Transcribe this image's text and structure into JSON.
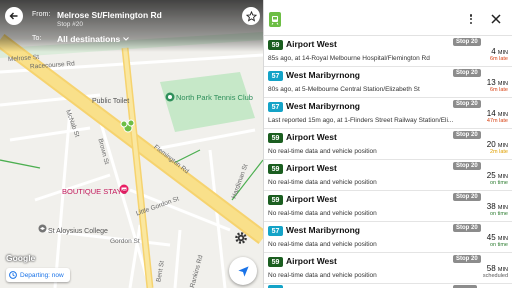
{
  "header": {
    "from_label": "From:",
    "from_value": "Melrose St/Flemington Rd",
    "stop_label": "Stop #20",
    "to_label": "To:",
    "to_value": "All destinations"
  },
  "map": {
    "labels": {
      "tennis": "North Park Tennis Club",
      "toilet": "Public Toilet",
      "boutique": "BOUTIQUE STAYS",
      "college": "St Aloysius College",
      "racecourse": "Racecourse Rd",
      "melrose": "Melrose St",
      "mcnab": "McNab St",
      "little_gordon": "Little Gordon St",
      "gordon": "Gordon St",
      "rankins": "Rankins Rd",
      "hardiman": "Hardiman St",
      "bent": "Bent St",
      "flemington": "Flemington Rd",
      "brown": "Brown St"
    },
    "google_text": "Google",
    "departing_text": "Departing: now"
  },
  "colors": {
    "route_59": "#1b5e20",
    "route_57": "#14a3c7",
    "late": "#d84315",
    "ontime": "#2e7d32",
    "scheduled": "#555555",
    "stop_badge": "#8c8c8c"
  },
  "departures": [
    {
      "route": "59",
      "color": "#1b5e20",
      "dest": "Airport West",
      "sub": "85s ago, at 14-Royal Melbourne Hospital/Flemington Rd",
      "stop": "Stop 20",
      "mins": "4",
      "unit": "MIN",
      "status": "6m late",
      "status_type": "late"
    },
    {
      "route": "57",
      "color": "#14a3c7",
      "dest": "West Maribyrnong",
      "sub": "80s ago, at 5-Melbourne Central Station/Elizabeth St",
      "stop": "Stop 20",
      "mins": "13",
      "unit": "MIN",
      "status": "6m late",
      "status_type": "late"
    },
    {
      "route": "57",
      "color": "#14a3c7",
      "dest": "West Maribyrnong",
      "sub": "Last reported 15m ago, at 1-Flinders Street Railway Station/Eli...",
      "stop": "Stop 20",
      "mins": "14",
      "unit": "MIN",
      "status": "47m late",
      "status_type": "late"
    },
    {
      "route": "59",
      "color": "#1b5e20",
      "dest": "Airport West",
      "sub": "No real-time data and vehicle position",
      "stop": "Stop 20",
      "mins": "20",
      "unit": "MIN",
      "status": "2m late",
      "status_type": "warn"
    },
    {
      "route": "59",
      "color": "#1b5e20",
      "dest": "Airport West",
      "sub": "No real-time data and vehicle position",
      "stop": "Stop 20",
      "mins": "25",
      "unit": "MIN",
      "status": "on time",
      "status_type": "ontime"
    },
    {
      "route": "59",
      "color": "#1b5e20",
      "dest": "Airport West",
      "sub": "No real-time data and vehicle position",
      "stop": "Stop 20",
      "mins": "38",
      "unit": "MIN",
      "status": "on time",
      "status_type": "ontime"
    },
    {
      "route": "57",
      "color": "#14a3c7",
      "dest": "West Maribyrnong",
      "sub": "No real-time data and vehicle position",
      "stop": "Stop 20",
      "mins": "45",
      "unit": "MIN",
      "status": "on time",
      "status_type": "ontime"
    },
    {
      "route": "59",
      "color": "#1b5e20",
      "dest": "Airport West",
      "sub": "No real-time data and vehicle position",
      "stop": "Stop 20",
      "mins": "58",
      "unit": "MIN",
      "status": "scheduled",
      "status_type": "scheduled"
    }
  ]
}
